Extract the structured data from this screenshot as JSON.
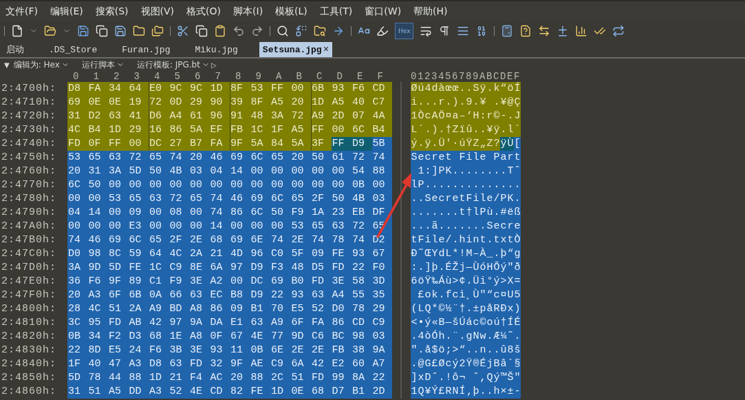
{
  "menu": [
    "文件(F)",
    "编辑(E)",
    "搜索(S)",
    "视图(V)",
    "格式(O)",
    "脚本(I)",
    "模板(L)",
    "工具(T)",
    "窗口(W)",
    "帮助(H)"
  ],
  "toolbar": {
    "hex_toggle": {
      "label": "Hex",
      "selected": true
    }
  },
  "tabs": [
    {
      "label": "启动",
      "selected": false
    },
    {
      "label": ".DS_Store",
      "selected": false
    },
    {
      "label": "Furan.jpg",
      "selected": false
    },
    {
      "label": "Miku.jpg",
      "selected": false
    },
    {
      "label": "Setsuna.jpg",
      "selected": true,
      "close": "×"
    }
  ],
  "subtoolbar": {
    "collapse": "▼",
    "edit_as": "编辑为: Hex",
    "run_script": "运行脚本",
    "run_template": "运行模板: JPG.bt",
    "play": "▷"
  },
  "columns": [
    "0",
    "1",
    "2",
    "3",
    "4",
    "5",
    "6",
    "7",
    "8",
    "9",
    "A",
    "B",
    "C",
    "D",
    "E",
    "F"
  ],
  "ascii_header": "0123456789ABCDEF",
  "rows": [
    {
      "address": "2:4700h:",
      "kind": "template",
      "bytes": [
        "D8",
        "FA",
        "34",
        "64",
        "E0",
        "9C",
        "9C",
        "1D",
        "8F",
        "53",
        "FF",
        "00",
        "6B",
        "93",
        "F6",
        "CD"
      ],
      "ascii": "Øú4dàœœ..Sÿ.k“öÍ"
    },
    {
      "address": "2:4710h:",
      "kind": "template",
      "bytes": [
        "69",
        "0E",
        "0E",
        "19",
        "72",
        "0D",
        "29",
        "90",
        "39",
        "8F",
        "A5",
        "20",
        "1D",
        "A5",
        "40",
        "C7"
      ],
      "ascii": "i...r.).9.¥ .¥@Ç"
    },
    {
      "address": "2:4720h:",
      "kind": "template",
      "bytes": [
        "31",
        "D2",
        "63",
        "41",
        "D6",
        "A4",
        "61",
        "96",
        "91",
        "48",
        "3A",
        "72",
        "A9",
        "2D",
        "07",
        "4A"
      ],
      "ascii": "1ÒcAÖ¤a–‘H:r©-.J"
    },
    {
      "address": "2:4730h:",
      "kind": "template",
      "bytes": [
        "4C",
        "B4",
        "1D",
        "29",
        "16",
        "86",
        "5A",
        "EF",
        "FB",
        "1C",
        "1F",
        "A5",
        "FF",
        "00",
        "6C",
        "B4"
      ],
      "ascii": "L´.).†Zïû..¥ÿ.l´"
    },
    {
      "address": "2:4740h:",
      "kind": "mixed",
      "segments": [
        {
          "kind": "template",
          "bytes": [
            "FD",
            "0F",
            "FF",
            "00",
            "DC",
            "27",
            "B7",
            "FA",
            "9F",
            "5A",
            "84",
            "5A",
            "3F"
          ]
        },
        {
          "kind": "found",
          "bytes": [
            "FF",
            "D9"
          ]
        },
        {
          "kind": "data",
          "bytes": [
            "5B"
          ]
        }
      ],
      "ascii": "ý.ÿ.Ü'·úŸZ„Z?ÿÙ["
    },
    {
      "address": "2:4750h:",
      "kind": "data",
      "bytes": [
        "53",
        "65",
        "63",
        "72",
        "65",
        "74",
        "20",
        "46",
        "69",
        "6C",
        "65",
        "20",
        "50",
        "61",
        "72",
        "74"
      ],
      "ascii": "Secret File Part"
    },
    {
      "address": "2:4760h:",
      "kind": "data",
      "bytes": [
        "20",
        "31",
        "3A",
        "5D",
        "50",
        "4B",
        "03",
        "04",
        "14",
        "00",
        "00",
        "00",
        "00",
        "00",
        "54",
        "88"
      ],
      "ascii": " 1:]PK........Tˆ"
    },
    {
      "address": "2:4770h:",
      "kind": "data",
      "bytes": [
        "6C",
        "50",
        "00",
        "00",
        "00",
        "00",
        "00",
        "00",
        "00",
        "00",
        "00",
        "00",
        "00",
        "00",
        "0B",
        "00"
      ],
      "ascii": "lP.............."
    },
    {
      "address": "2:4780h:",
      "kind": "data",
      "bytes": [
        "00",
        "00",
        "53",
        "65",
        "63",
        "72",
        "65",
        "74",
        "46",
        "69",
        "6C",
        "65",
        "2F",
        "50",
        "4B",
        "03"
      ],
      "ascii": "..SecretFile/PK."
    },
    {
      "address": "2:4790h:",
      "kind": "data",
      "bytes": [
        "04",
        "14",
        "00",
        "09",
        "00",
        "08",
        "00",
        "74",
        "86",
        "6C",
        "50",
        "F9",
        "1A",
        "23",
        "EB",
        "DF"
      ],
      "ascii": ".......t†lPù.#ëß"
    },
    {
      "address": "2:47A0h:",
      "kind": "data",
      "bytes": [
        "00",
        "00",
        "00",
        "E3",
        "00",
        "00",
        "00",
        "14",
        "00",
        "00",
        "00",
        "53",
        "65",
        "63",
        "72",
        "65"
      ],
      "ascii": "...ã.......Secre"
    },
    {
      "address": "2:47B0h:",
      "kind": "data",
      "bytes": [
        "74",
        "46",
        "69",
        "6C",
        "65",
        "2F",
        "2E",
        "68",
        "69",
        "6E",
        "74",
        "2E",
        "74",
        "78",
        "74",
        "D2"
      ],
      "ascii": "tFile/.hint.txtÒ"
    },
    {
      "address": "2:47C0h:",
      "kind": "data",
      "bytes": [
        "D0",
        "98",
        "8C",
        "59",
        "64",
        "4C",
        "2A",
        "21",
        "4D",
        "96",
        "C0",
        "5F",
        "09",
        "FE",
        "93",
        "67"
      ],
      "ascii": "Ð˜ŒYdL*!M–À_.þ“g"
    },
    {
      "address": "2:47D0h:",
      "kind": "data",
      "bytes": [
        "3A",
        "9D",
        "5D",
        "FE",
        "1C",
        "C9",
        "8E",
        "6A",
        "97",
        "D9",
        "F3",
        "48",
        "D5",
        "FD",
        "22",
        "F0"
      ],
      "ascii": ":.]þ.ÉŽj—ÙóHÕý\"ð"
    },
    {
      "address": "2:47E0h:",
      "kind": "data",
      "bytes": [
        "36",
        "F6",
        "9F",
        "89",
        "C1",
        "F9",
        "3E",
        "A2",
        "00",
        "DC",
        "69",
        "B0",
        "FD",
        "3E",
        "58",
        "3D"
      ],
      "ascii": "6öŸ‰Áù>¢.Üi°ý>X="
    },
    {
      "address": "2:47F0h:",
      "kind": "data",
      "bytes": [
        "20",
        "A3",
        "6F",
        "6B",
        "0A",
        "66",
        "63",
        "EC",
        "B8",
        "D9",
        "22",
        "93",
        "63",
        "A4",
        "55",
        "35"
      ],
      "ascii": " £ok.fcì¸Ù\"“c¤U5"
    },
    {
      "address": "2:4800h:",
      "kind": "data",
      "bytes": [
        "28",
        "4C",
        "51",
        "2A",
        "A9",
        "BD",
        "A8",
        "86",
        "09",
        "B1",
        "70",
        "E5",
        "52",
        "D0",
        "78",
        "29"
      ],
      "ascii": "(LQ*©½¨†.±påRÐx)"
    },
    {
      "address": "2:4810h:",
      "kind": "data",
      "bytes": [
        "3C",
        "95",
        "FD",
        "AB",
        "42",
        "97",
        "9A",
        "DA",
        "E1",
        "63",
        "A9",
        "6F",
        "FA",
        "86",
        "CD",
        "C9"
      ],
      "ascii": "<•ý«B—šÚác©oú†ÍÉ"
    },
    {
      "address": "2:4820h:",
      "kind": "data",
      "bytes": [
        "0B",
        "34",
        "F2",
        "D3",
        "68",
        "1E",
        "A8",
        "0F",
        "67",
        "4E",
        "77",
        "9D",
        "C6",
        "BC",
        "98",
        "03"
      ],
      "ascii": ".4òÓh.¨.gNw.Æ¼˜."
    },
    {
      "address": "2:4830h:",
      "kind": "data",
      "bytes": [
        "22",
        "8D",
        "E5",
        "24",
        "F6",
        "3B",
        "3E",
        "93",
        "11",
        "0B",
        "6E",
        "2E",
        "2E",
        "FB",
        "38",
        "9A"
      ],
      "ascii": "\".å$ö;>“..n..û8š"
    },
    {
      "address": "2:4840h:",
      "kind": "data",
      "bytes": [
        "1F",
        "40",
        "47",
        "A3",
        "D8",
        "63",
        "FD",
        "32",
        "9F",
        "AE",
        "C9",
        "6A",
        "42",
        "E2",
        "60",
        "A7"
      ],
      "ascii": ".@G£Øcý2Ÿ®ÉjBâ`§"
    },
    {
      "address": "2:4850h:",
      "kind": "data",
      "bytes": [
        "5D",
        "78",
        "44",
        "88",
        "1D",
        "21",
        "F4",
        "AC",
        "20",
        "88",
        "2C",
        "51",
        "FD",
        "99",
        "8A",
        "22"
      ],
      "ascii": "]xDˆ.!ô¬ ˆ,Qý™Š\""
    },
    {
      "address": "2:4860h:",
      "kind": "data",
      "bytes": [
        "31",
        "51",
        "A5",
        "DD",
        "A3",
        "52",
        "4E",
        "CD",
        "82",
        "FE",
        "1D",
        "0E",
        "68",
        "D7",
        "B1",
        "2D"
      ],
      "ascii": "1Q¥Ý£RNÍ‚þ..h×±-"
    }
  ]
}
